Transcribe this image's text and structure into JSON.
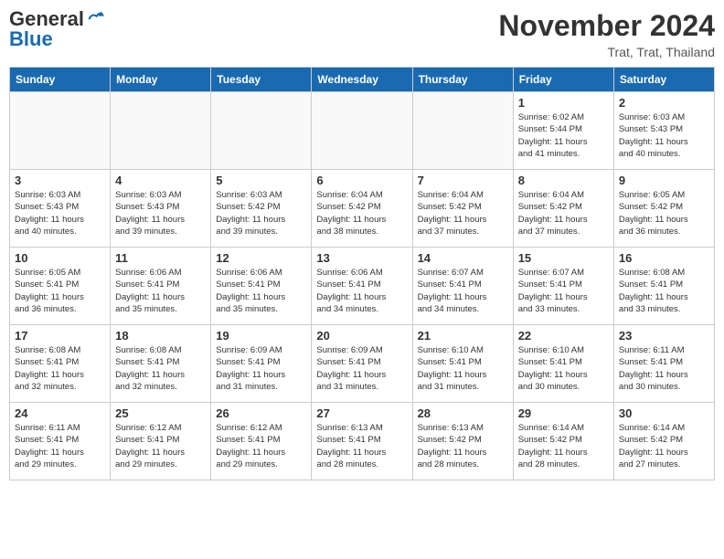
{
  "logo": {
    "line1": "General",
    "line2": "Blue"
  },
  "title": "November 2024",
  "location": "Trat, Trat, Thailand",
  "days_of_week": [
    "Sunday",
    "Monday",
    "Tuesday",
    "Wednesday",
    "Thursday",
    "Friday",
    "Saturday"
  ],
  "weeks": [
    [
      {
        "day": "",
        "info": ""
      },
      {
        "day": "",
        "info": ""
      },
      {
        "day": "",
        "info": ""
      },
      {
        "day": "",
        "info": ""
      },
      {
        "day": "",
        "info": ""
      },
      {
        "day": "1",
        "info": "Sunrise: 6:02 AM\nSunset: 5:44 PM\nDaylight: 11 hours\nand 41 minutes."
      },
      {
        "day": "2",
        "info": "Sunrise: 6:03 AM\nSunset: 5:43 PM\nDaylight: 11 hours\nand 40 minutes."
      }
    ],
    [
      {
        "day": "3",
        "info": "Sunrise: 6:03 AM\nSunset: 5:43 PM\nDaylight: 11 hours\nand 40 minutes."
      },
      {
        "day": "4",
        "info": "Sunrise: 6:03 AM\nSunset: 5:43 PM\nDaylight: 11 hours\nand 39 minutes."
      },
      {
        "day": "5",
        "info": "Sunrise: 6:03 AM\nSunset: 5:42 PM\nDaylight: 11 hours\nand 39 minutes."
      },
      {
        "day": "6",
        "info": "Sunrise: 6:04 AM\nSunset: 5:42 PM\nDaylight: 11 hours\nand 38 minutes."
      },
      {
        "day": "7",
        "info": "Sunrise: 6:04 AM\nSunset: 5:42 PM\nDaylight: 11 hours\nand 37 minutes."
      },
      {
        "day": "8",
        "info": "Sunrise: 6:04 AM\nSunset: 5:42 PM\nDaylight: 11 hours\nand 37 minutes."
      },
      {
        "day": "9",
        "info": "Sunrise: 6:05 AM\nSunset: 5:42 PM\nDaylight: 11 hours\nand 36 minutes."
      }
    ],
    [
      {
        "day": "10",
        "info": "Sunrise: 6:05 AM\nSunset: 5:41 PM\nDaylight: 11 hours\nand 36 minutes."
      },
      {
        "day": "11",
        "info": "Sunrise: 6:06 AM\nSunset: 5:41 PM\nDaylight: 11 hours\nand 35 minutes."
      },
      {
        "day": "12",
        "info": "Sunrise: 6:06 AM\nSunset: 5:41 PM\nDaylight: 11 hours\nand 35 minutes."
      },
      {
        "day": "13",
        "info": "Sunrise: 6:06 AM\nSunset: 5:41 PM\nDaylight: 11 hours\nand 34 minutes."
      },
      {
        "day": "14",
        "info": "Sunrise: 6:07 AM\nSunset: 5:41 PM\nDaylight: 11 hours\nand 34 minutes."
      },
      {
        "day": "15",
        "info": "Sunrise: 6:07 AM\nSunset: 5:41 PM\nDaylight: 11 hours\nand 33 minutes."
      },
      {
        "day": "16",
        "info": "Sunrise: 6:08 AM\nSunset: 5:41 PM\nDaylight: 11 hours\nand 33 minutes."
      }
    ],
    [
      {
        "day": "17",
        "info": "Sunrise: 6:08 AM\nSunset: 5:41 PM\nDaylight: 11 hours\nand 32 minutes."
      },
      {
        "day": "18",
        "info": "Sunrise: 6:08 AM\nSunset: 5:41 PM\nDaylight: 11 hours\nand 32 minutes."
      },
      {
        "day": "19",
        "info": "Sunrise: 6:09 AM\nSunset: 5:41 PM\nDaylight: 11 hours\nand 31 minutes."
      },
      {
        "day": "20",
        "info": "Sunrise: 6:09 AM\nSunset: 5:41 PM\nDaylight: 11 hours\nand 31 minutes."
      },
      {
        "day": "21",
        "info": "Sunrise: 6:10 AM\nSunset: 5:41 PM\nDaylight: 11 hours\nand 31 minutes."
      },
      {
        "day": "22",
        "info": "Sunrise: 6:10 AM\nSunset: 5:41 PM\nDaylight: 11 hours\nand 30 minutes."
      },
      {
        "day": "23",
        "info": "Sunrise: 6:11 AM\nSunset: 5:41 PM\nDaylight: 11 hours\nand 30 minutes."
      }
    ],
    [
      {
        "day": "24",
        "info": "Sunrise: 6:11 AM\nSunset: 5:41 PM\nDaylight: 11 hours\nand 29 minutes."
      },
      {
        "day": "25",
        "info": "Sunrise: 6:12 AM\nSunset: 5:41 PM\nDaylight: 11 hours\nand 29 minutes."
      },
      {
        "day": "26",
        "info": "Sunrise: 6:12 AM\nSunset: 5:41 PM\nDaylight: 11 hours\nand 29 minutes."
      },
      {
        "day": "27",
        "info": "Sunrise: 6:13 AM\nSunset: 5:41 PM\nDaylight: 11 hours\nand 28 minutes."
      },
      {
        "day": "28",
        "info": "Sunrise: 6:13 AM\nSunset: 5:42 PM\nDaylight: 11 hours\nand 28 minutes."
      },
      {
        "day": "29",
        "info": "Sunrise: 6:14 AM\nSunset: 5:42 PM\nDaylight: 11 hours\nand 28 minutes."
      },
      {
        "day": "30",
        "info": "Sunrise: 6:14 AM\nSunset: 5:42 PM\nDaylight: 11 hours\nand 27 minutes."
      }
    ]
  ]
}
